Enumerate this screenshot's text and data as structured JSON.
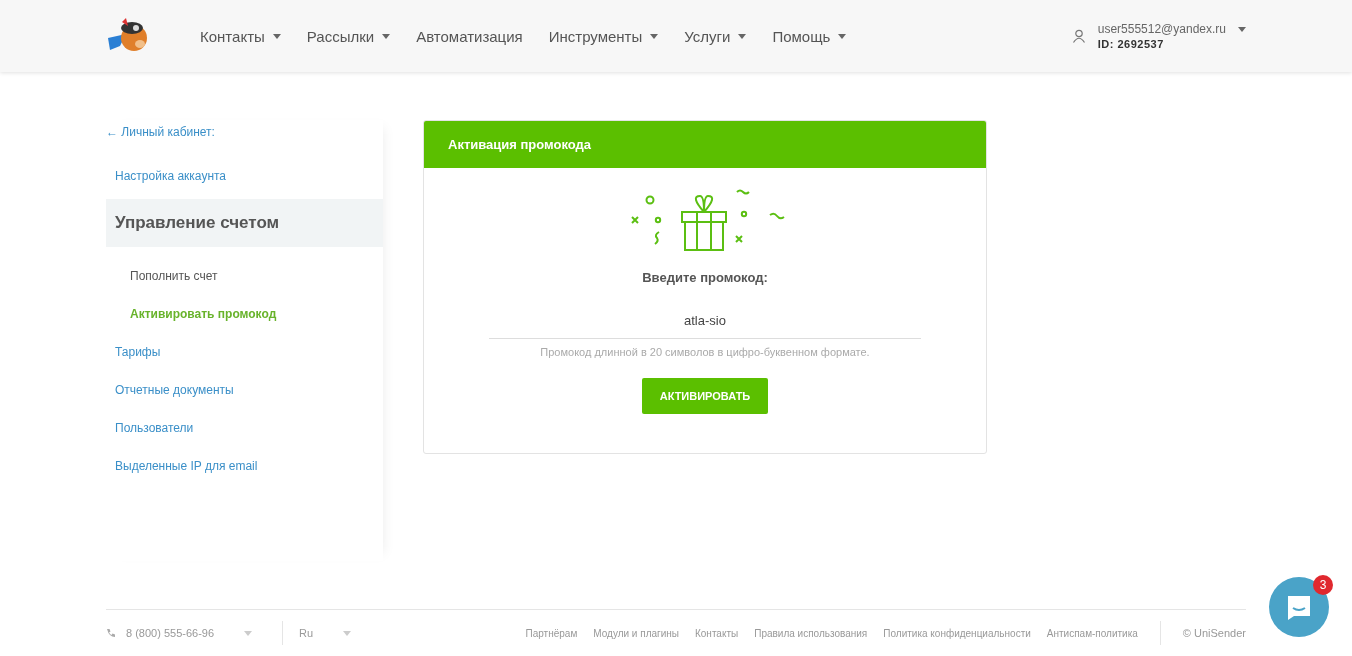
{
  "header": {
    "nav": [
      {
        "label": "Контакты",
        "dropdown": true
      },
      {
        "label": "Рассылки",
        "dropdown": true
      },
      {
        "label": "Автоматизация",
        "dropdown": false
      },
      {
        "label": "Инструменты",
        "dropdown": true
      },
      {
        "label": "Услуги",
        "dropdown": true
      },
      {
        "label": "Помощь",
        "dropdown": true
      }
    ],
    "user": {
      "email": "user555512@yandex.ru",
      "id": "ID: 2692537"
    }
  },
  "sidebar": {
    "back": "← Личный кабинет:",
    "items": [
      {
        "label": "Настройка аккаунта",
        "expanded": false
      },
      {
        "label": "Управление счетом",
        "expanded": true,
        "children": [
          {
            "label": "Пополнить счет",
            "selected": false
          },
          {
            "label": "Активировать промокод",
            "selected": true
          }
        ]
      },
      {
        "label": "Тарифы",
        "expanded": false
      },
      {
        "label": "Отчетные документы",
        "expanded": false
      },
      {
        "label": "Пользователи",
        "expanded": false
      },
      {
        "label": "Выделенные IP для email",
        "expanded": false
      }
    ]
  },
  "card": {
    "title": "Активация промокода",
    "prompt": "Введите промокод:",
    "value": "atla-sio",
    "hint": "Промокод длинной в 20 символов в цифро-буквенном формате.",
    "button": "АКТИВИРОВАТЬ"
  },
  "footer": {
    "phone": "8 (800) 555-66-96",
    "language": "Ru",
    "links": [
      "Партнёрам",
      "Модули и плагины",
      "Контакты",
      "Правила использования",
      "Политика конфиденциальности",
      "Антиспам-политика"
    ],
    "copyright": "© UniSender"
  },
  "chat": {
    "badge": "3"
  }
}
